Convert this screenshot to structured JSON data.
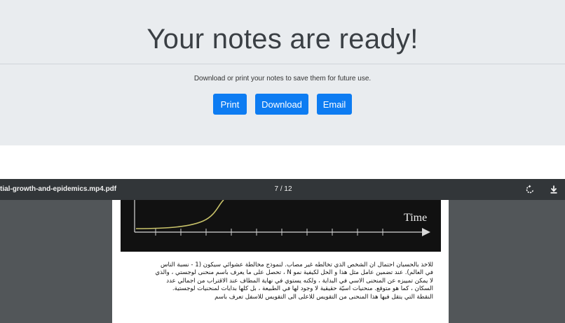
{
  "hero": {
    "title": "Your notes are ready!",
    "subtitle": "Download or print your notes to save them for future use.",
    "buttons": {
      "print": "Print",
      "download": "Download",
      "email": "Email"
    },
    "accent": "#0d7cf2"
  },
  "viewer": {
    "file_name": "tial-growth-and-epidemics.mp4.pdf",
    "page_indicator": "7 / 12",
    "icons": {
      "rotate": "rotate-icon",
      "download": "download-icon"
    },
    "page": {
      "graph_label": "Time",
      "lines": [
        "للاخذ بالحسبان احتمال ان الشخص الذي تخالطه غير مصاب. لنموذج مخالطة عشوائي سيكون (1 - نسبة الناس",
        "في العالم).   عند تضمين عامل مثل هذا و الحل لكيفية نمو N ، تحصل على ما يعرف باسم منحنى لوجستي ، والذي",
        "لا يمكن تمييزه عن المنحنى الاسي في البداية ، ولكنه يستوي في نهاية المطاف عند الاقتراب من اجمالي عدد",
        "السكان ، كما هو متوقع. منحنيات اسيّة حقيقية لا وجود لها في الطبيعة ، بل كلها بدايات لمنحنيات لوجستية.",
        "النقطة التي يتقل فيها هذا المنحنى من التقويس للاعلى الى التقويس للاسفل تعرف باسم"
      ]
    }
  }
}
